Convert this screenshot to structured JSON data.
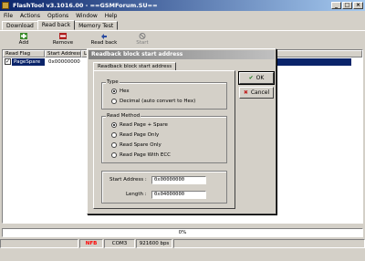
{
  "window": {
    "title": "FlashTool v3.1016.00 - ==GSMForum.SU==",
    "controls": [
      "_",
      "□",
      "×"
    ]
  },
  "menu": [
    "File",
    "Actions",
    "Options",
    "Window",
    "Help"
  ],
  "tabs": [
    "Download",
    "Read back",
    "Memory Test"
  ],
  "toolbar": {
    "add": "Add",
    "remove": "Remove",
    "read_back": "Read back",
    "start": "Start"
  },
  "list": {
    "columns": [
      "Read Flag",
      "Start Address",
      "L",
      "",
      ""
    ],
    "rows": [
      {
        "flag": "PageSpare",
        "start": "0x00000000"
      }
    ]
  },
  "dialog": {
    "title": "Readback block start address",
    "tab": "Readback block start address",
    "type_group": "Type",
    "type_options": [
      "Hex",
      "Decimal (auto convert to Hex)"
    ],
    "type_selected": 0,
    "method_group": "Read Method",
    "method_options": [
      "Read Page + Spare",
      "Read Page Only",
      "Read Spare Only",
      "Read Page With ECC"
    ],
    "method_selected": 0,
    "start_label": "Start Address :",
    "start_value": "0x00000000",
    "length_label": "Length :",
    "length_value": "0x04000000",
    "ok": "OK",
    "cancel": "Cancel"
  },
  "progress": {
    "text": "0%",
    "value": 0
  },
  "status": {
    "nfb": "NFB",
    "port": "COM3",
    "baud": "921600 bps"
  },
  "colors": {
    "titlebar": "#0a246a",
    "selection": "#0a246a",
    "face": "#d4d0c8",
    "nfb": "#ff0000"
  }
}
